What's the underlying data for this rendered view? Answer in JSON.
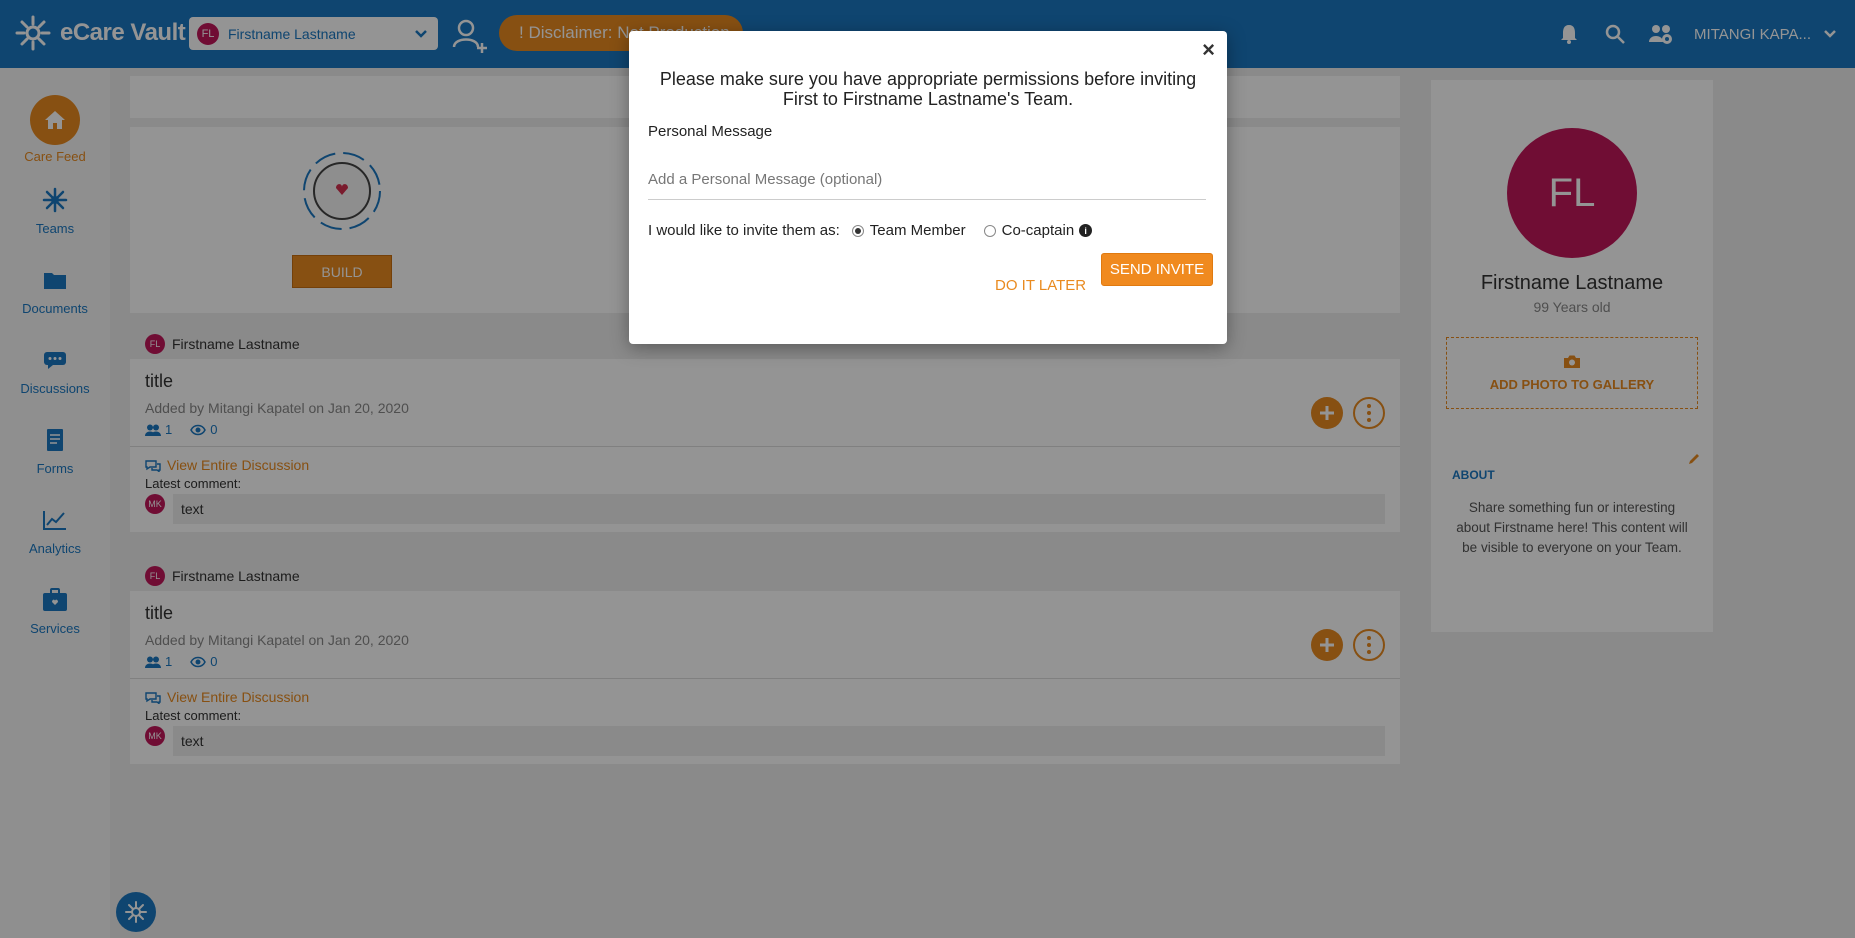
{
  "app": {
    "brand": "eCare Vault"
  },
  "topbar": {
    "patient_initials": "FL",
    "patient_name": "Firstname Lastname",
    "disclaimer": "! Disclaimer: Not Production",
    "user_name": "MITANGI KAPA..."
  },
  "sidebar": {
    "items": [
      {
        "label": "Care Feed",
        "icon": "home-icon",
        "active": true
      },
      {
        "label": "Teams",
        "icon": "snowflake-icon"
      },
      {
        "label": "Documents",
        "icon": "folder-icon"
      },
      {
        "label": "Discussions",
        "icon": "chat-icon"
      },
      {
        "label": "Forms",
        "icon": "form-icon"
      },
      {
        "label": "Analytics",
        "icon": "chart-icon"
      },
      {
        "label": "Services",
        "icon": "briefcase-icon"
      }
    ]
  },
  "build_card": {
    "button_label": "BUILD"
  },
  "feed": [
    {
      "author_initials": "FL",
      "author": "Firstname Lastname",
      "title": "title",
      "meta": "Added by Mitangi Kapatel on Jan 20, 2020",
      "members": "1",
      "views": "0",
      "view_link": "View Entire Discussion",
      "latest_label": "Latest comment:",
      "commenter_initials": "MK",
      "comment": "text"
    },
    {
      "author_initials": "FL",
      "author": "Firstname Lastname",
      "title": "title",
      "meta": "Added by Mitangi Kapatel on Jan 20, 2020",
      "members": "1",
      "views": "0",
      "view_link": "View Entire Discussion",
      "latest_label": "Latest comment:",
      "commenter_initials": "MK",
      "comment": "text"
    }
  ],
  "profile": {
    "initials": "FL",
    "name": "Firstname Lastname",
    "age": "99 Years old",
    "add_photo": "ADD PHOTO TO GALLERY",
    "about_label": "ABOUT",
    "about_text": "Share something fun or interesting about Firstname here! This content will be visible to everyone on your Team."
  },
  "modal": {
    "close": "×",
    "title": "Please make sure you have appropriate permissions before inviting First to Firstname Lastname's Team.",
    "message_label": "Personal Message",
    "message_placeholder": "Add a Personal Message (optional)",
    "invite_as_label": "I would like to invite them as:",
    "option_member": "Team Member",
    "option_cocaptain": "Co-captain",
    "selected": "Team Member",
    "later_label": "DO IT LATER",
    "send_label": "SEND INVITE"
  },
  "colors": {
    "primary": "#1a78c2",
    "accent": "#e98a1f",
    "avatar": "#c2185b"
  }
}
